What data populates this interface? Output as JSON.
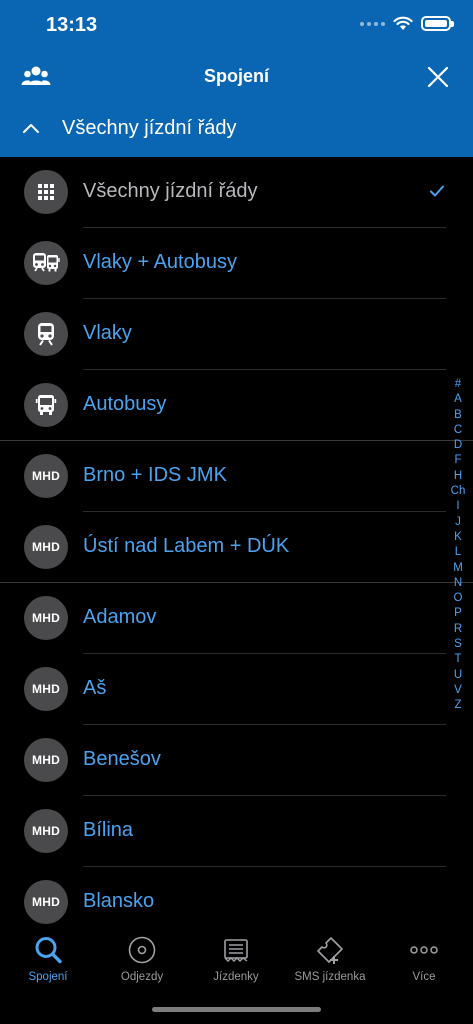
{
  "status": {
    "time": "13:13"
  },
  "nav": {
    "title": "Spojení"
  },
  "filter": {
    "label": "Všechny jízdní řády"
  },
  "list": [
    {
      "icon": "grid-icon",
      "label": "Všechny jízdní řády",
      "selected": true
    },
    {
      "icon": "train-bus-icon",
      "label": "Vlaky + Autobusy"
    },
    {
      "icon": "train-icon",
      "label": "Vlaky"
    },
    {
      "icon": "bus-icon",
      "label": "Autobusy"
    },
    {
      "icon": "mhd-badge",
      "badge": "MHD",
      "label": "Brno + IDS JMK"
    },
    {
      "icon": "mhd-badge",
      "badge": "MHD",
      "label": "Ústí nad Labem + DÚK"
    },
    {
      "icon": "mhd-badge",
      "badge": "MHD",
      "label": "Adamov"
    },
    {
      "icon": "mhd-badge",
      "badge": "MHD",
      "label": "Aš"
    },
    {
      "icon": "mhd-badge",
      "badge": "MHD",
      "label": "Benešov"
    },
    {
      "icon": "mhd-badge",
      "badge": "MHD",
      "label": "Bílina"
    },
    {
      "icon": "mhd-badge",
      "badge": "MHD",
      "label": "Blansko"
    }
  ],
  "index": [
    "#",
    "A",
    "B",
    "C",
    "D",
    "F",
    "H",
    "Ch",
    "I",
    "J",
    "K",
    "L",
    "M",
    "N",
    "O",
    "P",
    "R",
    "S",
    "T",
    "U",
    "V",
    "Z"
  ],
  "tabs": [
    {
      "icon": "search-icon",
      "label": "Spojení",
      "active": true
    },
    {
      "icon": "departures-icon",
      "label": "Odjezdy"
    },
    {
      "icon": "tickets-icon",
      "label": "Jízdenky"
    },
    {
      "icon": "sms-ticket-icon",
      "label": "SMS jízdenka"
    },
    {
      "icon": "more-icon",
      "label": "Více"
    }
  ],
  "colors": {
    "header": "#0a66b3",
    "accent": "#4ba3f0",
    "badge": "#4a4a4c",
    "background": "#000000"
  }
}
